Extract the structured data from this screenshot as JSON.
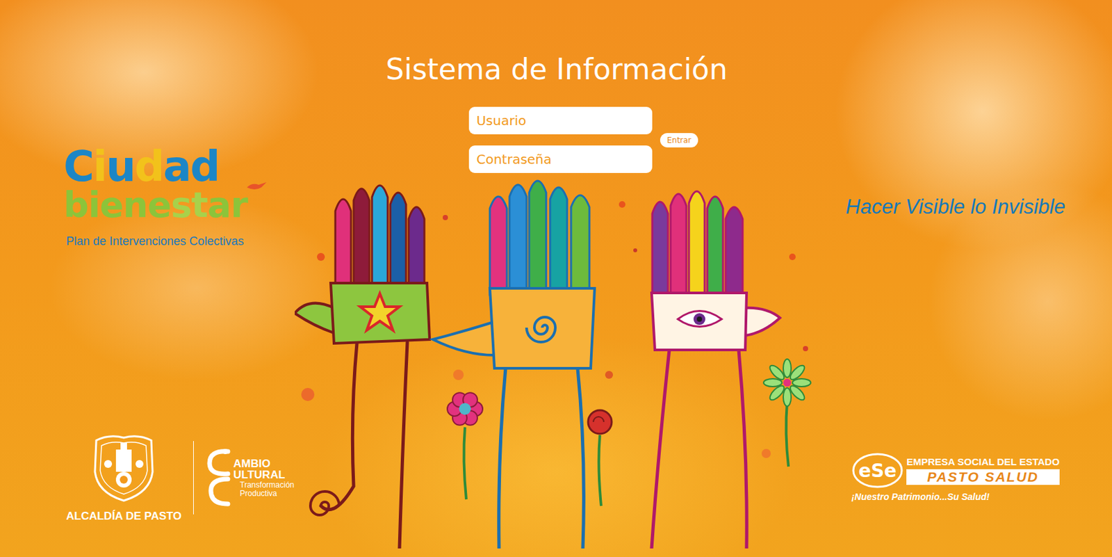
{
  "title": "Sistema de Información",
  "login": {
    "username_placeholder": "Usuario",
    "password_placeholder": "Contraseña",
    "submit": "Entrar"
  },
  "brand": {
    "logo_line1": "Ciudad",
    "logo_line2": "bienestar",
    "subtitle": "Plan de Intervenciones Colectivas"
  },
  "tagline": "Hacer Visible lo Invisible",
  "footer_left": {
    "crest_caption": "ALCALDÍA DE PASTO",
    "culture_logo": {
      "line1": "AMBIO",
      "line2": "ULTURAL",
      "line3": "Transformación",
      "line4": "Productiva"
    }
  },
  "footer_right": {
    "mark": "eSe",
    "line1": "EMPRESA SOCIAL DEL ESTADO",
    "line2": "PASTO SALUD",
    "motto": "¡Nuestro Patrimonio...Su Salud!"
  }
}
